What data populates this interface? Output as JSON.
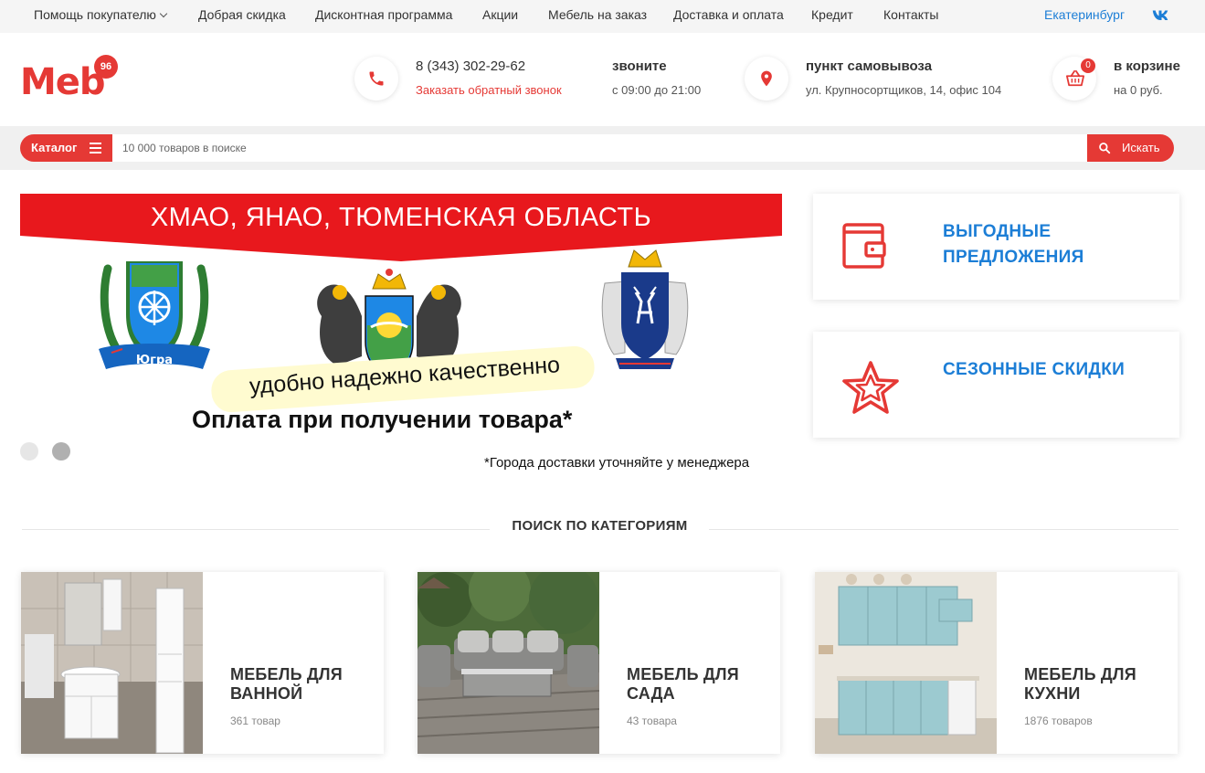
{
  "top_nav": {
    "items": [
      "Помощь покупателю",
      "Добрая скидка",
      "Дисконтная программа",
      "Акции",
      "Мебель на заказ",
      "Доставка и оплата",
      "Кредит",
      "Контакты"
    ],
    "city": "Екатеринбург",
    "social_icon": "vk-icon"
  },
  "header": {
    "logo_text": "Meb",
    "logo_badge": "96",
    "phone": "8 (343) 302-29-62",
    "callback_link": "Заказать обратный звонок",
    "hours_label": "звоните",
    "hours_value": "с 09:00 до 21:00",
    "pickup_label": "пункт самовывоза",
    "pickup_address": "ул. Крупносортщиков, 14, офис 104",
    "cart_count": "0",
    "cart_label": "в корзине",
    "cart_total": "на 0 руб."
  },
  "search": {
    "catalog_label": "Каталог",
    "placeholder": "10 000 товаров в поиске",
    "button_label": "Искать"
  },
  "banner": {
    "title": "ХМАО, ЯНАО, ТЮМЕНСКАЯ ОБЛАСТЬ",
    "crest_label": "Югра",
    "slogan": "удобно надежно качественно",
    "payment": "Оплата при получении товара*",
    "note": "*Города доставки уточняйте у менеджера",
    "active_slide": 2,
    "slide_count": 2
  },
  "promos": [
    {
      "line1": "ВЫГОДНЫЕ",
      "line2": "ПРЕДЛОЖЕНИЯ",
      "icon": "wallet-icon"
    },
    {
      "line1": "СЕЗОННЫЕ СКИДКИ",
      "line2": "",
      "icon": "star-icon"
    }
  ],
  "categories_title": "ПОИСК ПО КАТЕГОРИЯМ",
  "categories": [
    {
      "line1": "МЕБЕЛЬ ДЛЯ",
      "line2": "ВАННОЙ",
      "count": "361 товар"
    },
    {
      "line1": "МЕБЕЛЬ ДЛЯ",
      "line2": "САДА",
      "count": "43 товара"
    },
    {
      "line1": "МЕБЕЛЬ ДЛЯ",
      "line2": "КУХНИ",
      "count": "1876 товаров"
    }
  ],
  "colors": {
    "accent": "#e53935",
    "link": "#1c7ed6"
  }
}
